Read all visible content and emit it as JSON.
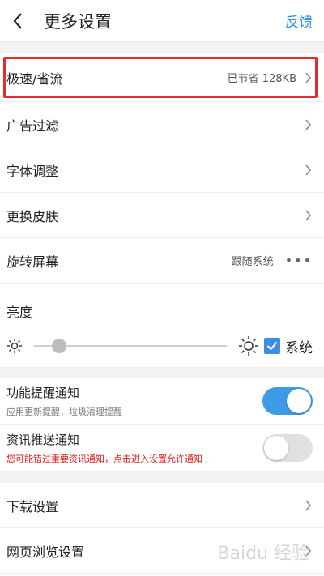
{
  "header": {
    "title": "更多设置",
    "feedback": "反馈",
    "back_icon": "chevron-left-icon"
  },
  "rows_top": [
    {
      "label": "极速/省流",
      "value": "已节省 128KB"
    },
    {
      "label": "广告过滤"
    },
    {
      "label": "字体调整"
    },
    {
      "label": "更换皮肤"
    },
    {
      "label": "旋转屏幕",
      "value": "跟随系统"
    }
  ],
  "brightness": {
    "label": "亮度",
    "level": 0.1,
    "system_label": "系统",
    "system_checked": true
  },
  "notifications": [
    {
      "title": "功能提醒通知",
      "subtitle": "应用更新提醒，垃圾清理提醒",
      "enabled": true
    },
    {
      "title": "资讯推送通知",
      "subtitle": "您可能错过重要资讯通知，点击进入设置允许通知",
      "enabled": false
    }
  ],
  "rows_bottom": [
    {
      "label": "下载设置"
    },
    {
      "label": "网页浏览设置"
    }
  ],
  "colors": {
    "accent": "#3d9be6",
    "link": "#2f8fe3",
    "warning": "#e02020",
    "highlight_border": "#e82a2a"
  },
  "watermark": "Baidu 经验"
}
